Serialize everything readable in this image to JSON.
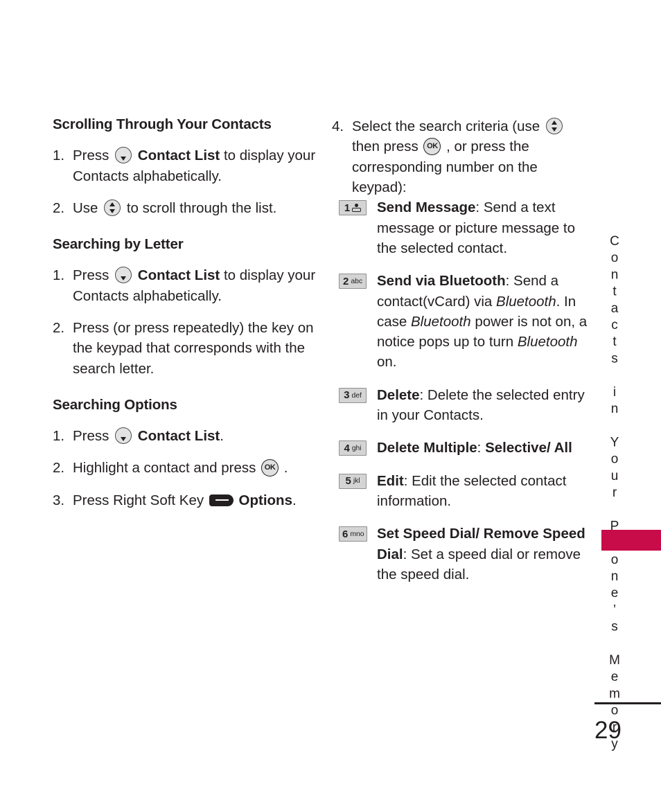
{
  "page": {
    "number": "29",
    "side_tab_text": "Contacts in Your Phone’s Memory",
    "tab_color": "#c80b49",
    "text_color": "#231f20"
  },
  "left_column": {
    "sections": [
      {
        "heading": "Scrolling Through Your Contacts",
        "steps": [
          {
            "num": "1.",
            "parts": [
              {
                "type": "text",
                "value": "Press "
              },
              {
                "type": "icon",
                "value": "nav-key-down"
              },
              {
                "type": "bold",
                "value": " Contact List"
              },
              {
                "type": "text",
                "value": " to display your Contacts alphabetically."
              }
            ]
          },
          {
            "num": "2.",
            "parts": [
              {
                "type": "text",
                "value": "Use "
              },
              {
                "type": "icon",
                "value": "nav-key-up-down"
              },
              {
                "type": "text",
                "value": " to scroll through the list."
              }
            ]
          }
        ]
      },
      {
        "heading": "Searching by Letter",
        "steps": [
          {
            "num": "1.",
            "parts": [
              {
                "type": "text",
                "value": "Press "
              },
              {
                "type": "icon",
                "value": "nav-key-down"
              },
              {
                "type": "bold",
                "value": " Contact List"
              },
              {
                "type": "text",
                "value": " to display your Contacts alphabetically."
              }
            ]
          },
          {
            "num": "2.",
            "parts": [
              {
                "type": "text",
                "value": "Press (or press repeatedly) the key on the keypad that corresponds with the search letter."
              }
            ]
          }
        ]
      },
      {
        "heading": "Searching Options",
        "steps": [
          {
            "num": "1.",
            "parts": [
              {
                "type": "text",
                "value": "Press "
              },
              {
                "type": "icon",
                "value": "nav-key-down"
              },
              {
                "type": "bold",
                "value": " Contact List"
              },
              {
                "type": "text",
                "value": "."
              }
            ]
          },
          {
            "num": "2.",
            "parts": [
              {
                "type": "text",
                "value": "Highlight a contact and press "
              },
              {
                "type": "icon",
                "value": "ok-key"
              },
              {
                "type": "text",
                "value": " ."
              }
            ]
          },
          {
            "num": "3.",
            "parts": [
              {
                "type": "text",
                "value": "Press Right Soft Key "
              },
              {
                "type": "icon",
                "value": "soft-key"
              },
              {
                "type": "text",
                "value": " "
              },
              {
                "type": "bold",
                "value": "Options"
              },
              {
                "type": "text",
                "value": "."
              }
            ]
          }
        ]
      }
    ]
  },
  "right_column": {
    "intro_step": {
      "num": "4.",
      "parts": [
        {
          "type": "text",
          "value": "Select the search criteria (use "
        },
        {
          "type": "icon",
          "value": "nav-key-up-down"
        },
        {
          "type": "text",
          "value": " then press "
        },
        {
          "type": "icon",
          "value": "ok-key"
        },
        {
          "type": "text",
          "value": " , or press the corresponding number on the keypad):"
        }
      ]
    },
    "key_options": [
      {
        "key_digit": "1",
        "key_letters": "",
        "key_glyph": "voicemail-icon",
        "parts": [
          {
            "type": "bold",
            "value": "Send Message"
          },
          {
            "type": "text",
            "value": ": Send a text message or picture message to the selected contact."
          }
        ]
      },
      {
        "key_digit": "2",
        "key_letters": "abc",
        "key_glyph": "",
        "parts": [
          {
            "type": "bold",
            "value": "Send via Bluetooth"
          },
          {
            "type": "text",
            "value": ": Send a contact(vCard) via "
          },
          {
            "type": "italic",
            "value": "Bluetooth"
          },
          {
            "type": "text",
            "value": ". In case "
          },
          {
            "type": "italic",
            "value": "Bluetooth"
          },
          {
            "type": "text",
            "value": " power is not on, a notice pops up to turn "
          },
          {
            "type": "italic",
            "value": "Bluetooth"
          },
          {
            "type": "text",
            "value": " on."
          }
        ]
      },
      {
        "key_digit": "3",
        "key_letters": "def",
        "key_glyph": "",
        "parts": [
          {
            "type": "bold",
            "value": "Delete"
          },
          {
            "type": "text",
            "value": ": Delete the selected entry in your Contacts."
          }
        ]
      },
      {
        "key_digit": "4",
        "key_letters": "ghi",
        "key_glyph": "",
        "parts": [
          {
            "type": "bold",
            "value": "Delete Multiple"
          },
          {
            "type": "text",
            "value": ": "
          },
          {
            "type": "bold",
            "value": "Selective/ All"
          }
        ]
      },
      {
        "key_digit": "5",
        "key_letters": "jkl",
        "key_glyph": "",
        "parts": [
          {
            "type": "bold",
            "value": "Edit"
          },
          {
            "type": "text",
            "value": ": Edit the selected contact information."
          }
        ]
      },
      {
        "key_digit": "6",
        "key_letters": "mno",
        "key_glyph": "",
        "parts": [
          {
            "type": "bold",
            "value": "Set Speed Dial/ Remove Speed Dial"
          },
          {
            "type": "text",
            "value": ": Set a speed dial or remove the speed dial."
          }
        ]
      }
    ]
  }
}
